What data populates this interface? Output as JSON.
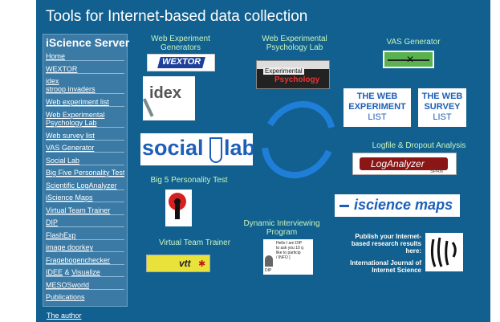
{
  "page": {
    "title": "Tools for Internet-based data collection"
  },
  "sidebar": {
    "heading": "iScience Server",
    "items": [
      {
        "label": "Home"
      },
      {
        "label": "WEXTOR"
      },
      {
        "label": "idex"
      },
      {
        "label": "stroop invaders"
      },
      {
        "label": "Web experiment list"
      },
      {
        "label": "Web Experimental"
      },
      {
        "label": "Psychology Lab"
      },
      {
        "label": "Web survey list"
      },
      {
        "label": "VAS Generator"
      },
      {
        "label": "Social Lab"
      },
      {
        "label": "Big Five Personality Test"
      },
      {
        "label": "Scientific LogAnalyzer"
      },
      {
        "label": "iScience Maps"
      },
      {
        "label": "Virtual Team Trainer"
      },
      {
        "label": "DIP"
      },
      {
        "label": "FlashExp"
      },
      {
        "label": "image doorkey"
      },
      {
        "label": "Fragebogenchecker"
      },
      {
        "label": "IDEE"
      },
      {
        "label": "&"
      },
      {
        "label": "Visualize"
      },
      {
        "label": "MESOSworld"
      },
      {
        "label": "Publications"
      }
    ],
    "author_link": "The author"
  },
  "captions": {
    "web_exp_generators_1": "Web Experiment",
    "web_exp_generators_2": "Generators",
    "wexp_lab_1": "Web Experimental",
    "wexp_lab_2": "Psychology Lab",
    "vas": "VAS Generator",
    "big5": "Big 5 Personality Test",
    "logfile": "Logfile & Dropout Analysis",
    "dip_1": "Dynamic Interviewing",
    "dip_2": "Program",
    "vtt": "Virtual Team Trainer"
  },
  "tiles": {
    "wextor": "WEXTOR",
    "idex": "idex",
    "wexp_lab_logo_1": "Experimental",
    "wexp_lab_logo_2": "Psychology",
    "web_exp_list_1": "THE WEB",
    "web_exp_list_2": "EXPERIMENT",
    "web_exp_list_3": "LIST",
    "web_survey_list_1": "THE WEB",
    "web_survey_list_2": "SURVEY",
    "web_survey_list_3": "LIST",
    "social_left": "social",
    "social_right": "lab",
    "loganalyzer": "LogAnalyzer",
    "sa_tag": "SPAN",
    "iscience_maps": "iscience maps",
    "vtt_logo": "vtt",
    "dip_text": [
      "Hello I am DIP",
      "to ask you 10 q",
      "like to particip",
      "/ INFO ]"
    ],
    "dip_label": "DIP"
  },
  "publish": {
    "line1": "Publish your Internet-",
    "line2": "based research results",
    "line3": "here:",
    "line4": "International Journal of",
    "line5": "Internet Science"
  },
  "colors": {
    "page_bg": "#11608f",
    "sidebar_bg": "#3a7aa5",
    "caption": "#c7f5c0",
    "accent_blue": "#1d5fb8",
    "vtt_yellow": "#e8e23a"
  }
}
